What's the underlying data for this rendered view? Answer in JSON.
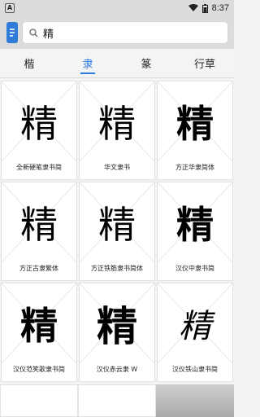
{
  "status": {
    "time": "8:37",
    "left_badge": "A"
  },
  "search": {
    "value": "精"
  },
  "tabs": [
    {
      "label": "楷"
    },
    {
      "label": "隶"
    },
    {
      "label": "篆"
    },
    {
      "label": "行草"
    }
  ],
  "active_tab_color": "#2f7bd8",
  "items": [
    {
      "glyph": "精",
      "caption": "全新硬笔隶书简"
    },
    {
      "glyph": "精",
      "caption": "华文隶书"
    },
    {
      "glyph": "精",
      "caption": "方正华隶简体"
    },
    {
      "glyph": "精",
      "caption": "方正古隶繁体"
    },
    {
      "glyph": "精",
      "caption": "方正铁筋隶书简体"
    },
    {
      "glyph": "精",
      "caption": "汉仪中隶书简"
    },
    {
      "glyph": "精",
      "caption": "汉仪范笑歌隶书简"
    },
    {
      "glyph": "精",
      "caption": "汉仪赤云隶 W"
    },
    {
      "glyph": "精",
      "caption": "汉仪铁山隶书简"
    }
  ]
}
